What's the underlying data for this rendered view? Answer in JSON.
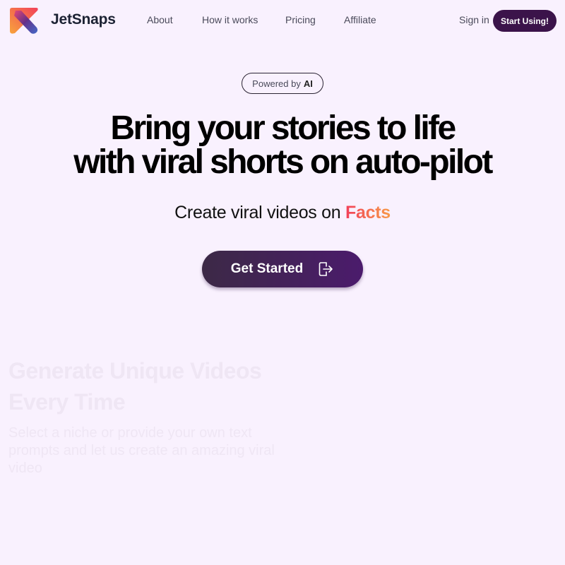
{
  "nav": {
    "brand": "JetSnaps",
    "links": [
      "About",
      "How it works",
      "Pricing",
      "Affiliate"
    ],
    "sign_in": "Sign in",
    "start_using": "Start Using!"
  },
  "hero": {
    "badge_prefix": "Powered by",
    "badge_strong": "AI",
    "headline_line1": "Bring your stories to life",
    "headline_line2": "with viral shorts on auto-pilot",
    "subline_prefix": "Create viral videos on",
    "subline_accent": "Facts",
    "cta_label": "Get Started",
    "cta_icon": "sign-in-arrow-icon"
  },
  "feature": {
    "title": "Generate Unique Videos Every Time",
    "text": "Select a niche or provide your own text prompts and let us create an amazing viral video"
  },
  "colors": {
    "background": "#f9f1fe",
    "primary": "#3b134a",
    "accent_start": "#f2405a",
    "accent_end": "#f89a47"
  }
}
